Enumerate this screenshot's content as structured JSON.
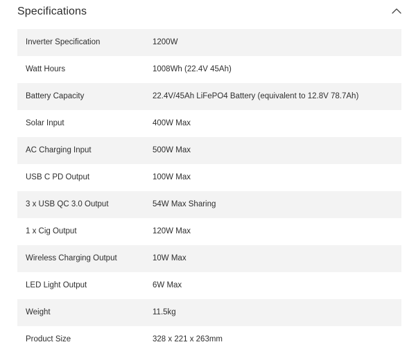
{
  "section": {
    "title": "Specifications",
    "toggle_icon": "chevron-up-icon"
  },
  "specs": [
    {
      "label": "Inverter Specification",
      "value": "1200W"
    },
    {
      "label": "Watt Hours",
      "value": "1008Wh (22.4V 45Ah)"
    },
    {
      "label": "Battery Capacity",
      "value": "22.4V/45Ah LiFePO4 Battery (equivalent to 12.8V 78.7Ah)"
    },
    {
      "label": "Solar Input",
      "value": "400W Max"
    },
    {
      "label": "AC Charging Input",
      "value": "500W Max"
    },
    {
      "label": "USB C PD Output",
      "value": "100W Max"
    },
    {
      "label": "3 x USB QC 3.0 Output",
      "value": "54W Max Sharing"
    },
    {
      "label": "1 x Cig Output",
      "value": "120W Max"
    },
    {
      "label": "Wireless Charging Output",
      "value": "10W Max"
    },
    {
      "label": "LED Light Output",
      "value": "6W Max"
    },
    {
      "label": "Weight",
      "value": "11.5kg"
    },
    {
      "label": "Product Size",
      "value": "328 x 221 x 263mm"
    }
  ]
}
